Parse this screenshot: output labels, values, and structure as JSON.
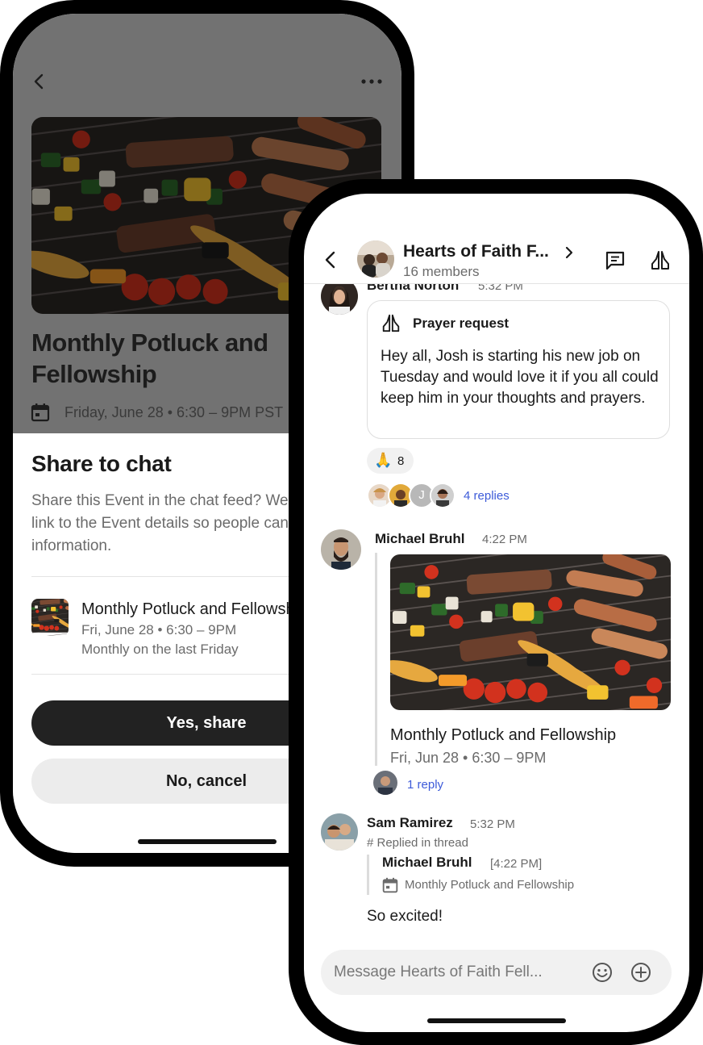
{
  "event_screen": {
    "event_title": "Monthly Potluck and Fellowship",
    "event_datetime": "Friday, June 28 • 6:30 – 9PM PST"
  },
  "share_sheet": {
    "title": "Share to chat",
    "description": "Share this Event in the chat feed? We'll include a link to the Event details so people can find more information.",
    "event_title": "Monthly Potluck and Fellowship",
    "event_date": "Fri, June 28 • 6:30 – 9PM",
    "event_recurrence": "Monthly on the last Friday",
    "confirm_label": "Yes, share",
    "cancel_label": "No, cancel"
  },
  "chat": {
    "group_name": "Hearts of Faith F...",
    "members": "16 members",
    "messages": [
      {
        "author": "Bertha Norton",
        "time": "5:32 PM",
        "card_title": "Prayer request",
        "card_body": "Hey all, Josh is starting his new job on Tuesday and would love it if you all could keep him in your thoughts and prayers.",
        "reaction_emoji": "🙏",
        "reaction_count": "8",
        "replies_initial": "J",
        "replies_label": "4 replies"
      },
      {
        "author": "Michael Bruhl",
        "time": "4:22 PM",
        "event_title": "Monthly Potluck and Fellowship",
        "event_date": "Fri, Jun 28 • 6:30 – 9PM",
        "replies_label": "1 reply"
      },
      {
        "author": "Sam Ramirez",
        "time": "5:32 PM",
        "replied_label": "# Replied in thread",
        "quote_author": "Michael Bruhl",
        "quote_time": "[4:22 PM]",
        "quote_text": "Monthly Potluck and Fellowship",
        "text": "So excited!"
      }
    ],
    "composer_placeholder": "Message Hearts of Faith Fell..."
  },
  "colors": {
    "link": "#3d5bd9",
    "primary_button": "#222222",
    "secondary_button": "#ececec"
  }
}
